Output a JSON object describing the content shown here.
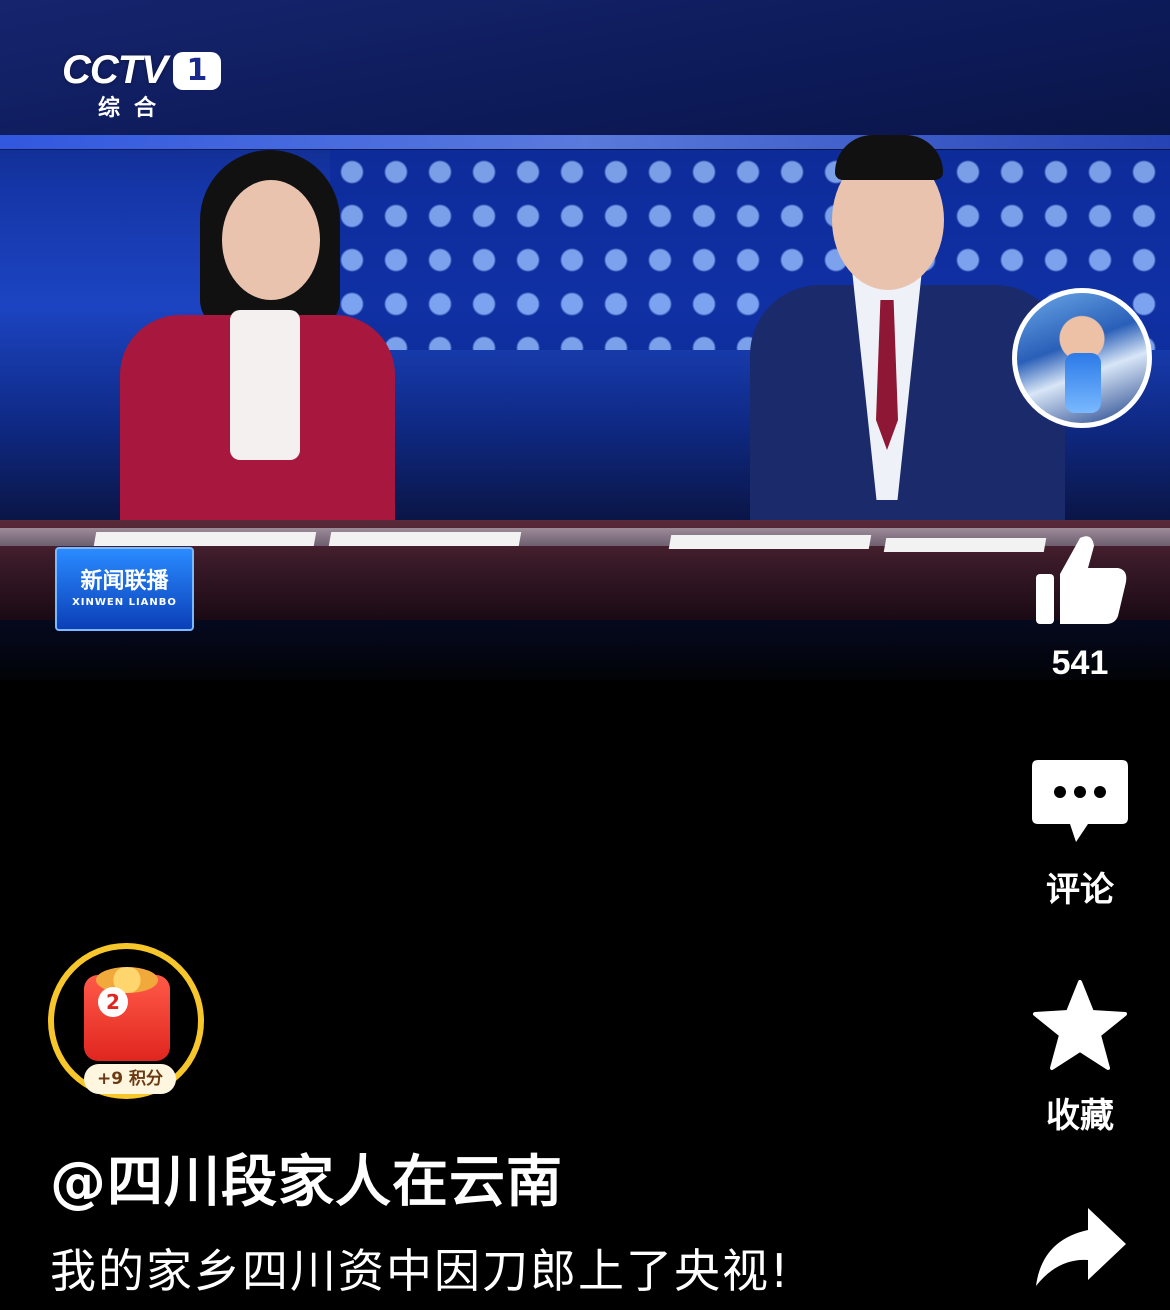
{
  "video": {
    "channel_logo_text": "CCTV",
    "channel_number": "1",
    "channel_sub": "综合",
    "program_cn": "新闻联播",
    "program_en": "XINWEN LIANBO"
  },
  "actions": {
    "like_count": "541",
    "comment_label": "评论",
    "favorite_label": "收藏"
  },
  "reward": {
    "badge_text": "2",
    "points_text": "+9 积分"
  },
  "post": {
    "author": "@四川段家人在云南",
    "description": "我的家乡四川资中因刀郎上了央视!"
  },
  "colors": {
    "background": "#000000",
    "reward_ring": "#f6c62a",
    "reward_box": "#e0261f"
  }
}
